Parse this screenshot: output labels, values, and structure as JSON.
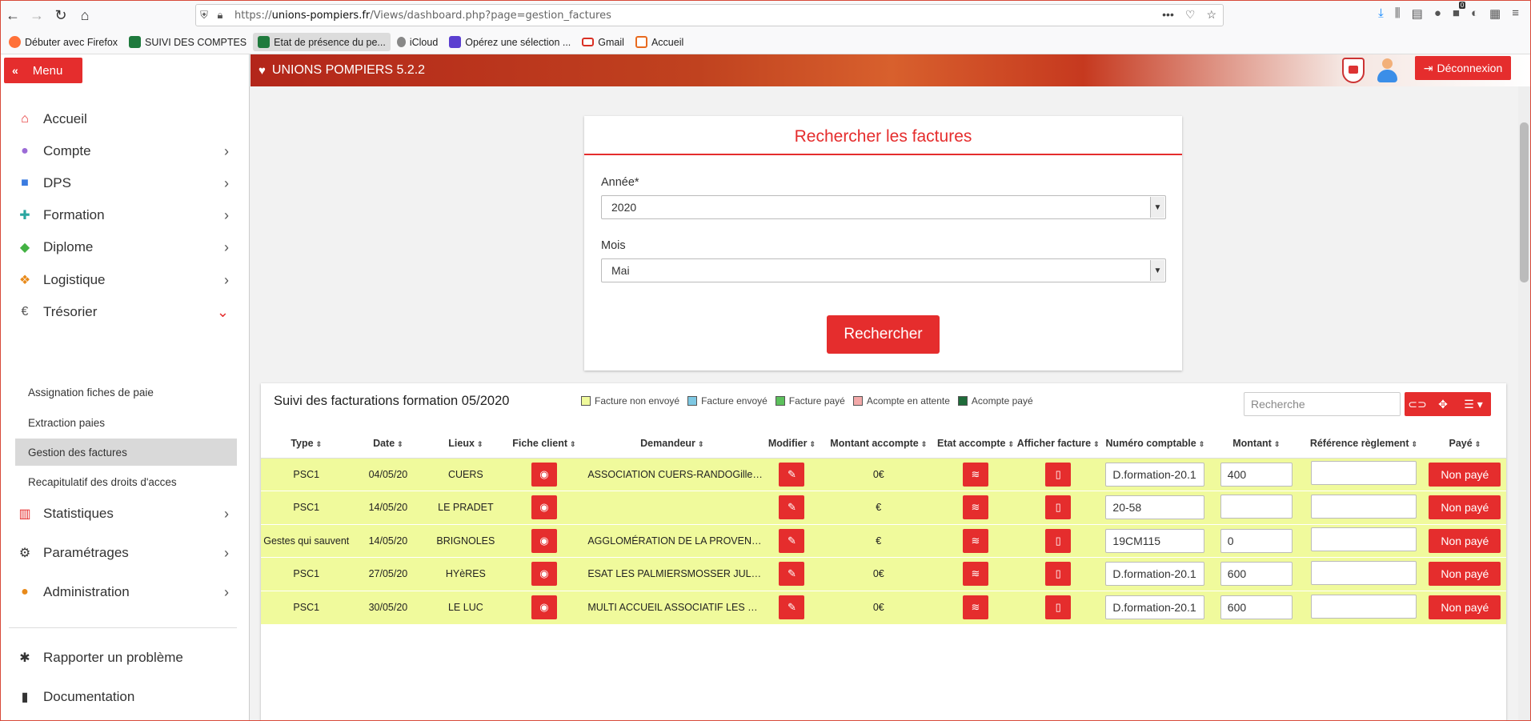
{
  "browser": {
    "url_prefix": "https://",
    "url_host": "unions-pompiers.fr",
    "url_path": "/Views/dashboard.php?page=gestion_factures",
    "badge_count": "0",
    "bookmarks": [
      {
        "label": "Débuter avec Firefox",
        "color": "#ff7139"
      },
      {
        "label": "SUIVI DES COMPTES",
        "color": "#1f7a3d"
      },
      {
        "label": "Etat de présence du pe...",
        "color": "#1f7a3d"
      },
      {
        "label": "iCloud",
        "color": "#888888"
      },
      {
        "label": "Opérez une sélection ...",
        "color": "#5b3fd0"
      },
      {
        "label": "Gmail",
        "color": "#d93025"
      },
      {
        "label": "Accueil",
        "color": "#e86a1f"
      }
    ]
  },
  "sidebar": {
    "menu_label": "Menu",
    "items": [
      {
        "label": "Accueil",
        "icon": "home-icon",
        "color": "#e52d2d",
        "chevron": ""
      },
      {
        "label": "Compte",
        "icon": "user-icon",
        "color": "#9b6bd6",
        "chevron": "›"
      },
      {
        "label": "DPS",
        "icon": "ambulance-icon",
        "color": "#3b7be0",
        "chevron": "›"
      },
      {
        "label": "Formation",
        "icon": "medkit-icon",
        "color": "#2aa6a0",
        "chevron": "›"
      },
      {
        "label": "Diplome",
        "icon": "graduation-cap-icon",
        "color": "#43b243",
        "chevron": "›"
      },
      {
        "label": "Logistique",
        "icon": "cubes-icon",
        "color": "#e88a1a",
        "chevron": "›"
      },
      {
        "label": "Trésorier",
        "icon": "euro-icon",
        "color": "#555555",
        "chevron": "⌄"
      }
    ],
    "sub_items": [
      "Assignation fiches de paie",
      "Extraction paies",
      "Gestion des factures",
      "Recapitulatif des droits d'acces"
    ],
    "items2": [
      {
        "label": "Statistiques",
        "icon": "bar-chart-icon",
        "color": "#e52d2d",
        "chevron": "›"
      },
      {
        "label": "Paramétrages",
        "icon": "cogs-icon",
        "color": "#333333",
        "chevron": "›"
      },
      {
        "label": "Administration",
        "icon": "users-cog-icon",
        "color": "#e88a1a",
        "chevron": "›"
      }
    ],
    "footer": [
      {
        "label": "Rapporter un problème",
        "icon": "bug-icon"
      },
      {
        "label": "Documentation",
        "icon": "book-icon"
      }
    ]
  },
  "header": {
    "brand": "UNIONS POMPIERS 5.2.2",
    "logout_label": "Déconnexion"
  },
  "search_card": {
    "title": "Rechercher les factures",
    "year_label": "Année*",
    "year_value": "2020",
    "month_label": "Mois",
    "month_value": "Mai",
    "button_label": "Rechercher"
  },
  "table": {
    "title": "Suivi des facturations formation 05/2020",
    "search_placeholder": "Recherche",
    "legend": [
      {
        "label": "Facture non envoyé",
        "color": "#f0fa9c"
      },
      {
        "label": "Facture envoyé",
        "color": "#7ec8e3"
      },
      {
        "label": "Facture payé",
        "color": "#5cc05c"
      },
      {
        "label": "Acompte en attente",
        "color": "#f3a9a9"
      },
      {
        "label": "Acompte payé",
        "color": "#1f6b3a"
      }
    ],
    "columns": [
      "Type",
      "Date",
      "Lieux",
      "Fiche client",
      "Demandeur",
      "Modifier",
      "Montant accompte",
      "Etat accompte",
      "Afficher facture",
      "Numéro comptable",
      "Montant",
      "Référence règlement",
      "Payé"
    ],
    "rows": [
      {
        "type": "PSC1",
        "date": "04/05/20",
        "lieux": "CUERS",
        "demandeur": "ASSOCIATION CUERS-RANDOGilles ...",
        "montant_accompte": "0€",
        "numero": "D.formation-20.1",
        "montant": "400",
        "reference": "",
        "paye": "Non payé"
      },
      {
        "type": "PSC1",
        "date": "14/05/20",
        "lieux": "LE PRADET",
        "demandeur": "",
        "montant_accompte": "€",
        "numero": "20-58",
        "montant": "",
        "reference": "",
        "paye": "Non payé"
      },
      {
        "type": "Gestes qui sauvent",
        "date": "14/05/20",
        "lieux": "BRIGNOLES",
        "demandeur": "AGGLOMÉRATION DE LA PROVENC...",
        "montant_accompte": "€",
        "numero": "19CM115",
        "montant": "0",
        "reference": "",
        "paye": "Non payé"
      },
      {
        "type": "PSC1",
        "date": "27/05/20",
        "lieux": "HYèRES",
        "demandeur": "ESAT LES PALMIERSMOSSER JULIEN ...",
        "montant_accompte": "0€",
        "numero": "D.formation-20.1",
        "montant": "600",
        "reference": "",
        "paye": "Non payé"
      },
      {
        "type": "PSC1",
        "date": "30/05/20",
        "lieux": "LE LUC",
        "demandeur": "MULTI ACCUEIL ASSOCIATIF LES PIT...",
        "montant_accompte": "0€",
        "numero": "D.formation-20.1",
        "montant": "600",
        "reference": "",
        "paye": "Non payé"
      }
    ]
  }
}
